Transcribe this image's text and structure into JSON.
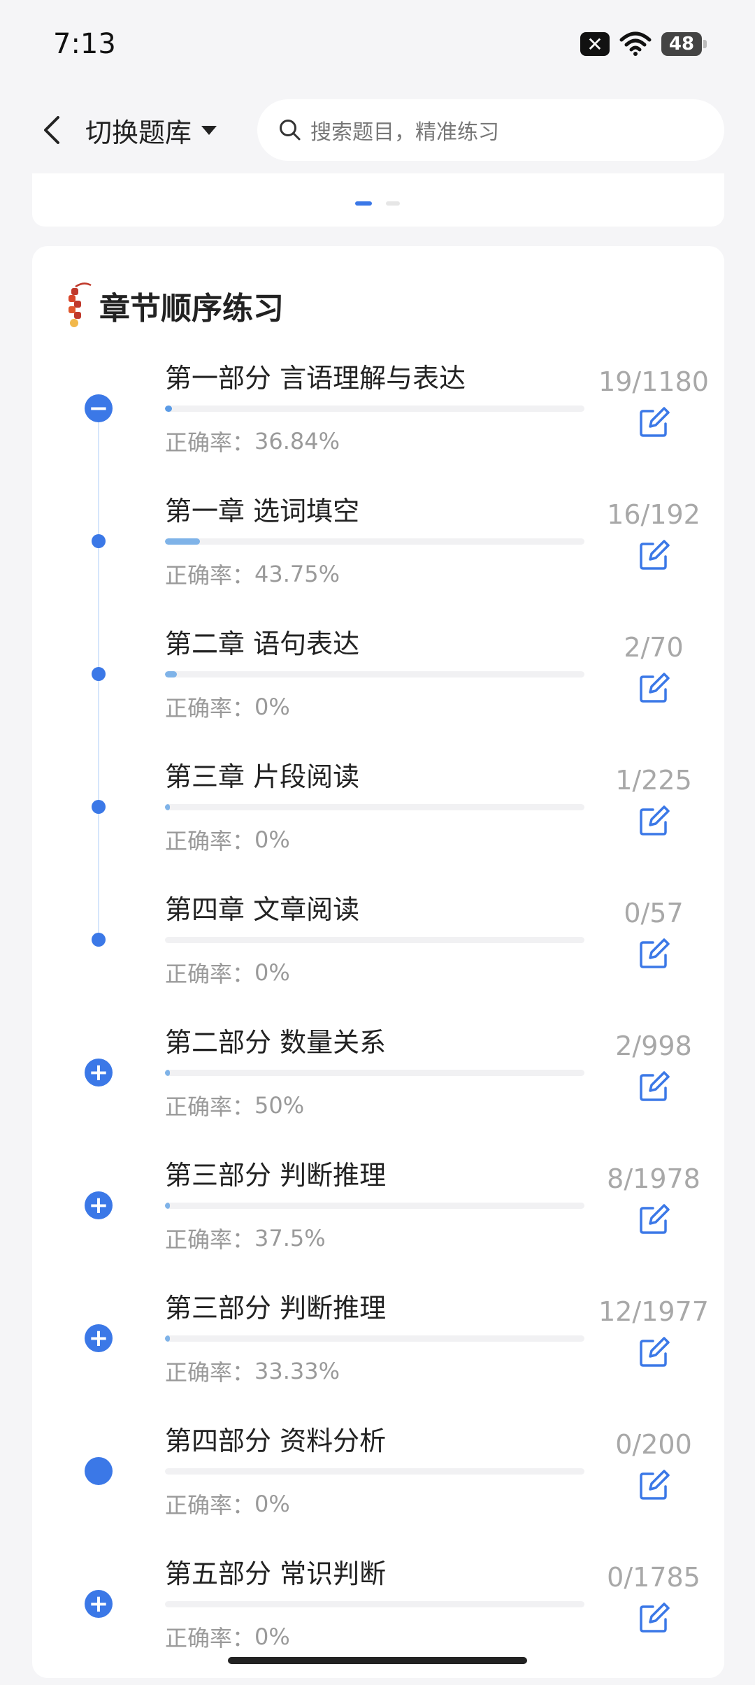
{
  "status": {
    "time": "7:13",
    "battery": "48"
  },
  "header": {
    "bank_switch_label": "切换题库",
    "search_placeholder": "搜索题目，精准练习"
  },
  "carousel": {
    "pages": 2,
    "active": 1
  },
  "section": {
    "title": "章节顺序练习"
  },
  "accuracy_label": "正确率：",
  "rows": [
    {
      "title": "第一部分 言语理解与表达",
      "count": "19/1180",
      "accuracy": "36.84%",
      "progress": 0.016,
      "marker": "minus"
    },
    {
      "title": "第一章 选词填空",
      "count": "16/192",
      "accuracy": "43.75%",
      "progress": 0.083,
      "marker": "dot"
    },
    {
      "title": "第二章 语句表达",
      "count": "2/70",
      "accuracy": "0%",
      "progress": 0.029,
      "marker": "dot"
    },
    {
      "title": "第三章 片段阅读",
      "count": "1/225",
      "accuracy": "0%",
      "progress": 0.004,
      "marker": "dot"
    },
    {
      "title": "第四章 文章阅读",
      "count": "0/57",
      "accuracy": "0%",
      "progress": 0.0,
      "marker": "dot"
    },
    {
      "title": "第二部分 数量关系",
      "count": "2/998",
      "accuracy": "50%",
      "progress": 0.002,
      "marker": "plus"
    },
    {
      "title": "第三部分 判断推理",
      "count": "8/1978",
      "accuracy": "37.5%",
      "progress": 0.004,
      "marker": "plus"
    },
    {
      "title": "第三部分 判断推理",
      "count": "12/1977",
      "accuracy": "33.33%",
      "progress": 0.006,
      "marker": "plus"
    },
    {
      "title": "第四部分 资料分析",
      "count": "0/200",
      "accuracy": "0%",
      "progress": 0.0,
      "marker": "filled"
    },
    {
      "title": "第五部分 常识判断",
      "count": "0/1785",
      "accuracy": "0%",
      "progress": 0.0,
      "marker": "plus"
    }
  ]
}
